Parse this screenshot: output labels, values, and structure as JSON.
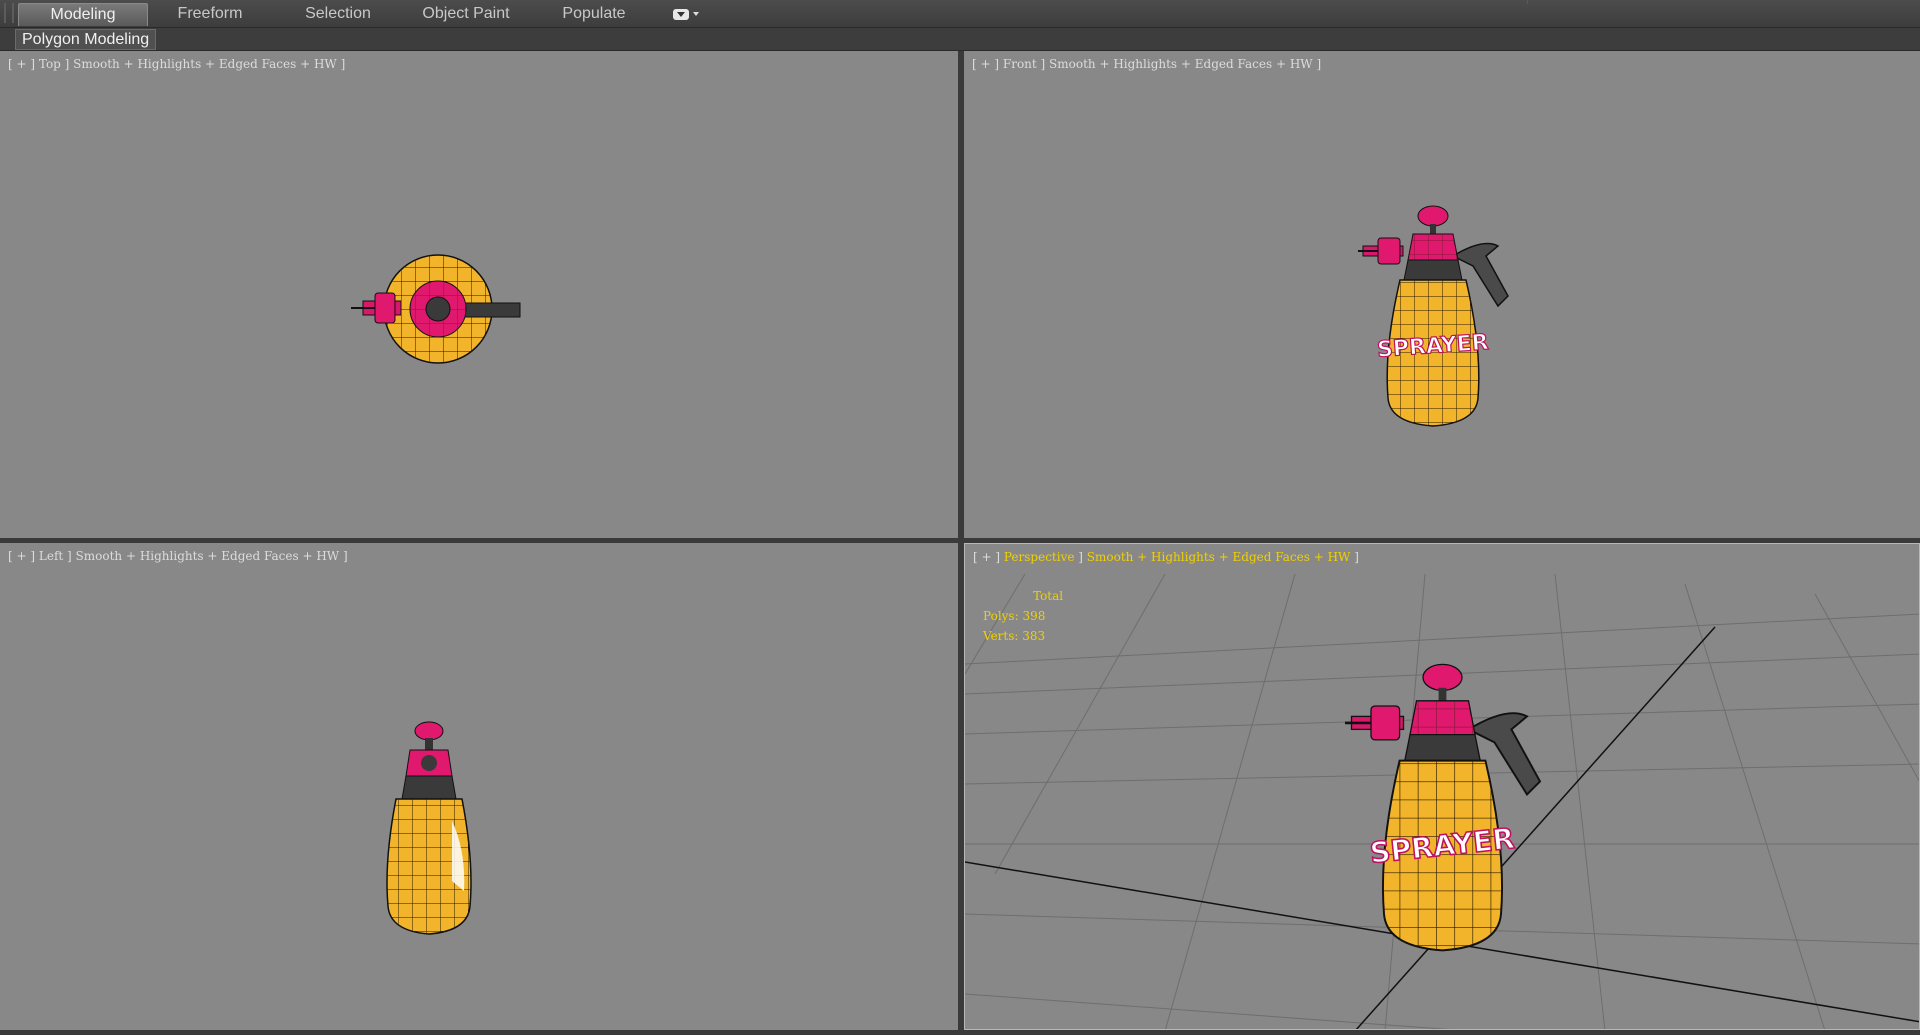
{
  "ribbon": {
    "tabs": [
      {
        "label": "Modeling",
        "active": true
      },
      {
        "label": "Freeform"
      },
      {
        "label": "Selection"
      },
      {
        "label": "Object Paint"
      },
      {
        "label": "Populate"
      }
    ],
    "dropdown_icon": "ribbon-options-icon"
  },
  "panel": {
    "label": "Polygon Modeling"
  },
  "viewports": {
    "top": {
      "open": "[ + ] ",
      "view": "Top",
      "mode": " ] Smooth + Highlights + Edged Faces + HW ]"
    },
    "front": {
      "open": "[ + ] ",
      "view": "Front",
      "mode": " ] Smooth + Highlights + Edged Faces + HW ]"
    },
    "left": {
      "open": "[ + ] ",
      "view": "Left",
      "mode": " ] Smooth + Highlights + Edged Faces + HW ]"
    },
    "perspective": {
      "open": "[ + ] ",
      "view": "Perspective",
      "sep": " ] ",
      "mode": "Smooth + Highlights + Edged Faces + HW",
      "close": " ]",
      "stats": {
        "title": "Total",
        "polys": "Polys: 398",
        "verts": "Verts: 383"
      }
    }
  },
  "model": {
    "label_text": "SPRAYER",
    "body_color": "#f2b42a",
    "cap_color": "#e0186e",
    "dark_color": "#3a3a3a"
  },
  "colors": {
    "viewport_bg": "#888888",
    "label_highlight": "#f0d000",
    "ui_bg": "#3a3a3a"
  }
}
